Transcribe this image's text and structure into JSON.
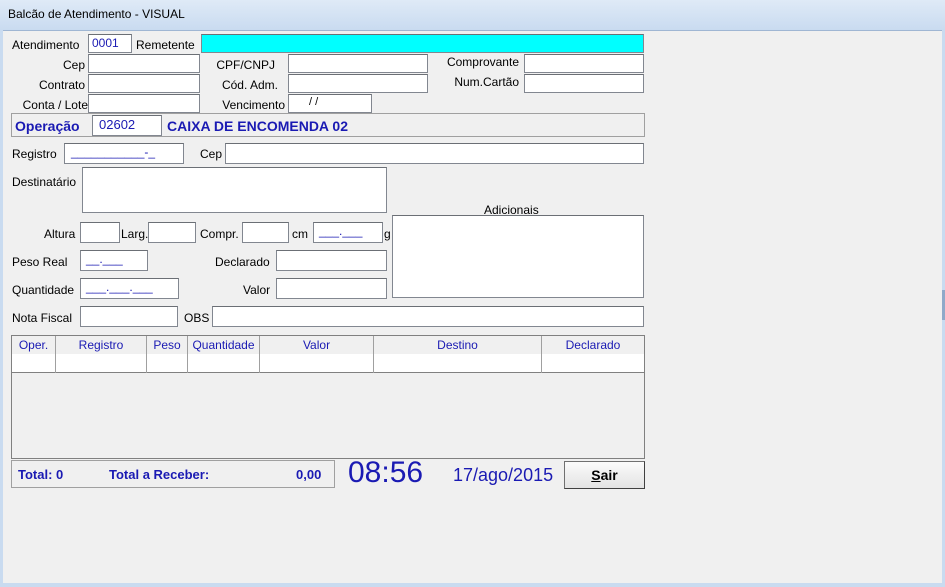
{
  "window": {
    "title": "Balcão de Atendimento - VISUAL"
  },
  "header": {
    "atendimento_label": "Atendimento",
    "atendimento_value": "0001",
    "remetente_label": "Remetente",
    "remetente_value": "",
    "cep_label": "Cep",
    "contrato_label": "Contrato",
    "conta_label": "Conta / Lote",
    "cpf_label": "CPF/CNPJ",
    "cod_adm_label": "Cód. Adm.",
    "vencimento_label": "Vencimento",
    "vencimento_value": "  /  /",
    "comprovante_label": "Comprovante",
    "num_cartao_label": "Num.Cartão"
  },
  "operacao": {
    "label": "Operação",
    "code": "02602",
    "description": "CAIXA DE ENCOMENDA 02"
  },
  "form": {
    "registro_label": "Registro",
    "registro_mask": "___________-_",
    "cep_label": "Cep",
    "destinatario_label": "Destinatário",
    "adicionais_label": "Adicionais",
    "altura_label": "Altura",
    "larg_label": "Larg.",
    "compr_label": "Compr.",
    "cm_label": "cm",
    "peso_mask": "___.___",
    "g_label": "g",
    "peso_real_label": "Peso Real",
    "peso_real_mask": "__.___",
    "declarado_label": "Declarado",
    "quantidade_label": "Quantidade",
    "quantidade_mask": "___.___.___",
    "valor_label": "Valor",
    "nota_fiscal_label": "Nota Fiscal",
    "obs_label": "OBS"
  },
  "table": {
    "columns": [
      "Oper.",
      "Registro",
      "Peso",
      "Quantidade",
      "Valor",
      "Destino",
      "Declarado"
    ]
  },
  "footer": {
    "total_label": "Total: 0",
    "total_receber_label": "Total a Receber:",
    "total_receber_value": "0,00",
    "time": "08:56",
    "date": "17/ago/2015",
    "sair_label": "Sair"
  },
  "colors": {
    "accent_text": "#1a1ab3",
    "remetente_bg": "#00ffff"
  }
}
